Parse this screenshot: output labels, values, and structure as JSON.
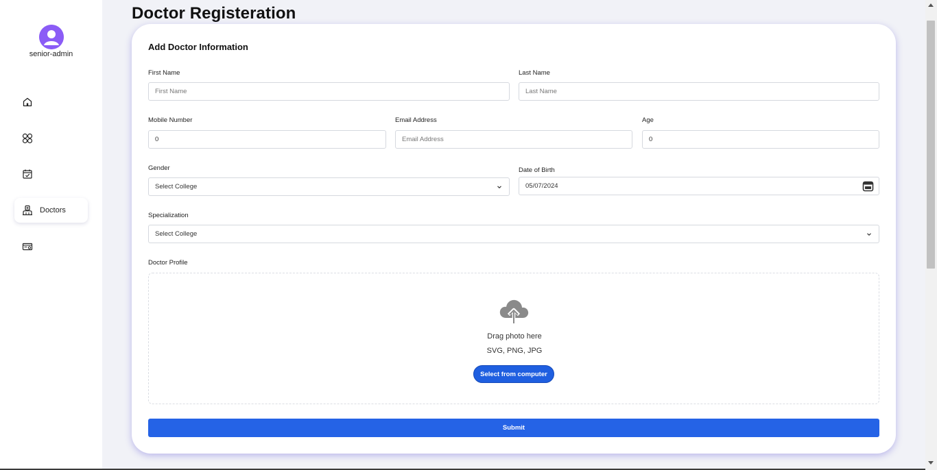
{
  "sidebar": {
    "username": "senior-admin",
    "items": [
      {
        "icon": "home-icon",
        "label": ""
      },
      {
        "icon": "grid-icon",
        "label": ""
      },
      {
        "icon": "calendar-check-icon",
        "label": ""
      },
      {
        "icon": "doctor-icon",
        "label": "Doctors"
      },
      {
        "icon": "id-card-icon",
        "label": ""
      }
    ]
  },
  "page": {
    "title": "Doctor Registeration"
  },
  "form": {
    "title": "Add Doctor Information",
    "first_name": {
      "label": "First Name",
      "placeholder": "First Name"
    },
    "last_name": {
      "label": "Last Name",
      "placeholder": "Last Name"
    },
    "mobile": {
      "label": "Mobile Number",
      "value": "0"
    },
    "email": {
      "label": "Email Address",
      "placeholder": "Email Address"
    },
    "age": {
      "label": "Age",
      "value": "0"
    },
    "gender": {
      "label": "Gender",
      "value": "Select College"
    },
    "dob": {
      "label": "Date of Birth",
      "value": "05/07/2024"
    },
    "specialization": {
      "label": "Specialization",
      "value": "Select College"
    },
    "profile": {
      "label": "Doctor Profile",
      "drag_text": "Drag photo here",
      "formats": "SVG, PNG, JPG",
      "select_button": "Select from computer"
    },
    "submit_label": "Submit"
  },
  "colors": {
    "primary": "#2563e6",
    "avatar": "#8b5cf6",
    "page_bg": "#f1f2f7"
  }
}
